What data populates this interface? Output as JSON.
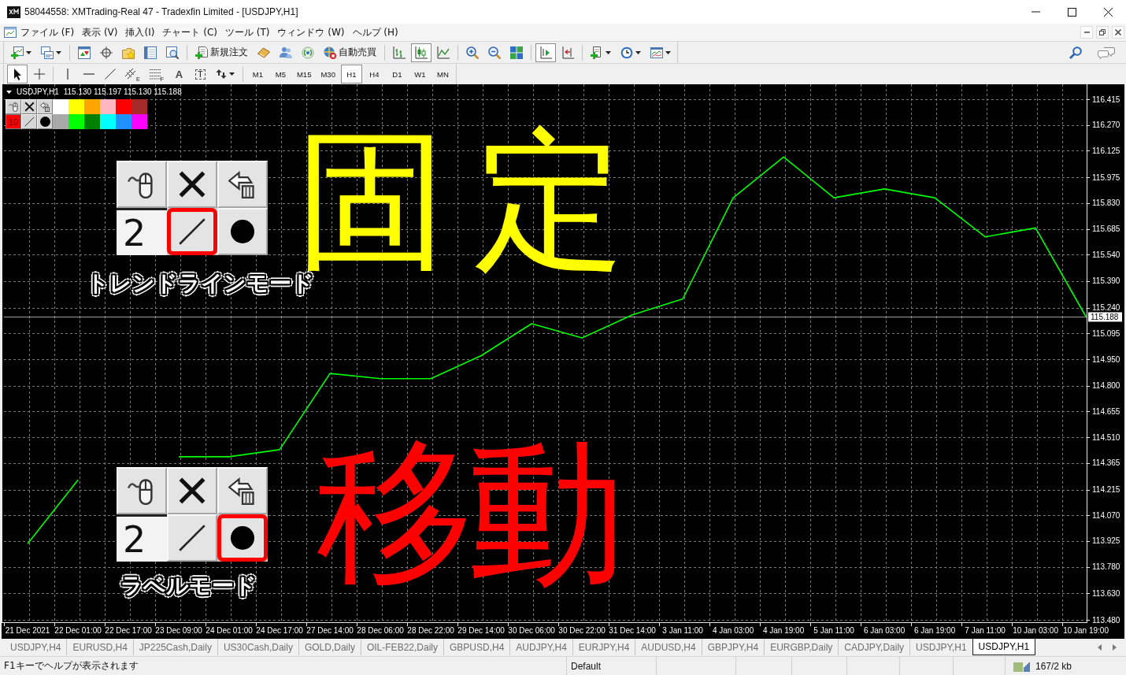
{
  "window": {
    "title": "58044558: XMTrading-Real 47 - Tradexfin Limited - [USDJPY,H1]"
  },
  "menu": [
    "ファイル (F)",
    "表示 (V)",
    "挿入(I)",
    "チャート (C)",
    "ツール (T)",
    "ウィンドウ (W)",
    "ヘルプ (H)"
  ],
  "toolbar": {
    "new_order": "新規注文",
    "auto_trading": "自動売買",
    "chart_types": [
      {
        "selected": false
      },
      {
        "selected": true
      },
      {
        "selected": false
      }
    ],
    "auto_scroll": {
      "on": true
    },
    "chart_shift": {
      "on": false
    }
  },
  "drawing_toolbar": {
    "cursor_modes": [
      {
        "selected": true
      },
      {
        "selected": false
      }
    ],
    "channel_tool": "E",
    "fibo_tool": "F",
    "text_tool": "A",
    "label_tool": "T",
    "timeframes": [
      {
        "label": "M1",
        "selected": false
      },
      {
        "label": "M5",
        "selected": false
      },
      {
        "label": "M15",
        "selected": false
      },
      {
        "label": "M30",
        "selected": false
      },
      {
        "label": "H1",
        "selected": true
      },
      {
        "label": "H4",
        "selected": false
      },
      {
        "label": "D1",
        "selected": false
      },
      {
        "label": "W1",
        "selected": false
      },
      {
        "label": "MN",
        "selected": false
      }
    ]
  },
  "chart": {
    "ohlc": "115.130 115.197 115.130 115.188",
    "chart_data": {
      "type": "line",
      "grid": true,
      "x": [
        "21 Dec 2021",
        "22 Dec 01:00",
        "22 Dec 17:00",
        "23 Dec 09:00",
        "24 Dec 01:00",
        "24 Dec 17:00",
        "27 Dec 14:00",
        "28 Dec 06:00",
        "28 Dec 22:00",
        "29 Dec 14:00",
        "30 Dec 06:00",
        "30 Dec 22:00",
        "31 Dec 14:00",
        "3 Jan 11:00",
        "4 Jan 03:00",
        "4 Jan 19:00",
        "5 Jan 11:00",
        "6 Jan 03:00",
        "6 Jan 19:00",
        "7 Jan 11:00",
        "10 Jan 03:00",
        "10 Jan 19:00"
      ],
      "series": [
        {
          "name": "USDJPY,H1",
          "color": "#00ff00",
          "values": [
            113.91,
            114.27,
            null,
            114.4,
            114.4,
            114.44,
            114.87,
            114.84,
            114.84,
            114.97,
            115.15,
            115.07,
            115.2,
            115.29,
            115.86,
            116.09,
            115.86,
            115.91,
            115.86,
            115.64,
            115.69,
            115.19
          ]
        }
      ],
      "ylim": [
        113.467,
        116.5
      ],
      "yticks": [
        {
          "value": 116.415,
          "label": "116.415"
        },
        {
          "value": 116.27,
          "label": "116.270"
        },
        {
          "value": 116.125,
          "label": "116.125"
        },
        {
          "value": 115.975,
          "label": "115.975"
        },
        {
          "value": 115.83,
          "label": "115.830"
        },
        {
          "value": 115.685,
          "label": "115.685"
        },
        {
          "value": 115.54,
          "label": "115.540"
        },
        {
          "value": 115.39,
          "label": "115.390"
        },
        {
          "value": 115.24,
          "label": "115.240"
        },
        {
          "value": 115.095,
          "label": "115.095"
        },
        {
          "value": 114.95,
          "label": "114.950"
        },
        {
          "value": 114.8,
          "label": "114.800"
        },
        {
          "value": 114.655,
          "label": "114.655"
        },
        {
          "value": 114.51,
          "label": "114.510"
        },
        {
          "value": 114.365,
          "label": "114.365"
        },
        {
          "value": 114.215,
          "label": "114.215"
        },
        {
          "value": 114.07,
          "label": "114.070"
        },
        {
          "value": 113.925,
          "label": "113.925"
        },
        {
          "value": 113.78,
          "label": "113.780"
        },
        {
          "value": 113.63,
          "label": "113.630"
        },
        {
          "value": 113.48,
          "label": "113.480"
        }
      ],
      "ref_lines": [
        {
          "axis": "y",
          "value": 115.188,
          "label": "115.188"
        }
      ]
    },
    "mini_palette": {
      "size": "10",
      "colors": [
        {
          "color": "#ffffff"
        },
        {
          "color": "#ffff00"
        },
        {
          "color": "#ffa500"
        },
        {
          "color": "#ffb6c1"
        },
        {
          "color": "#ff0000"
        },
        {
          "color": "#a52a2a"
        },
        {
          "color": "#a9a9a9"
        },
        {
          "color": "#00ff00"
        },
        {
          "color": "#008000"
        },
        {
          "color": "#00ffff"
        },
        {
          "color": "#1e90ff"
        },
        {
          "color": "#ff00ff"
        }
      ]
    },
    "callouts": [
      {
        "size": "2",
        "tools": [
          {
            "highlighted": false
          },
          {
            "highlighted": false
          },
          {
            "highlighted": false
          },
          {
            "highlighted": true
          },
          {
            "highlighted": false
          }
        ],
        "caption": "トレンドラインモード",
        "label": "固定",
        "color": "#ffff00"
      },
      {
        "size": "2",
        "tools": [
          {
            "highlighted": false
          },
          {
            "highlighted": false
          },
          {
            "highlighted": false
          },
          {
            "highlighted": false
          },
          {
            "highlighted": true
          }
        ],
        "caption": "ラベルモード",
        "label": "移動",
        "color": "#ff0000"
      }
    ]
  },
  "tabs": [
    {
      "label": "USDJPY,H4",
      "selected": false
    },
    {
      "label": "EURUSD,H4",
      "selected": false
    },
    {
      "label": "JP225Cash,Daily",
      "selected": false
    },
    {
      "label": "US30Cash,Daily",
      "selected": false
    },
    {
      "label": "GOLD,Daily",
      "selected": false
    },
    {
      "label": "OIL-FEB22,Daily",
      "selected": false
    },
    {
      "label": "GBPUSD,H4",
      "selected": false
    },
    {
      "label": "AUDJPY,H4",
      "selected": false
    },
    {
      "label": "EURJPY,H4",
      "selected": false
    },
    {
      "label": "AUDUSD,H4",
      "selected": false
    },
    {
      "label": "GBPJPY,H4",
      "selected": false
    },
    {
      "label": "EURGBP,Daily",
      "selected": false
    },
    {
      "label": "CADJPY,Daily",
      "selected": false
    },
    {
      "label": "USDJPY,H1",
      "selected": false
    },
    {
      "label": "USDJPY,H1",
      "selected": true
    }
  ],
  "status_bar": {
    "help": "F1キーでヘルプが表示されます",
    "profile": "Default",
    "traffic": "167/2 kb"
  }
}
